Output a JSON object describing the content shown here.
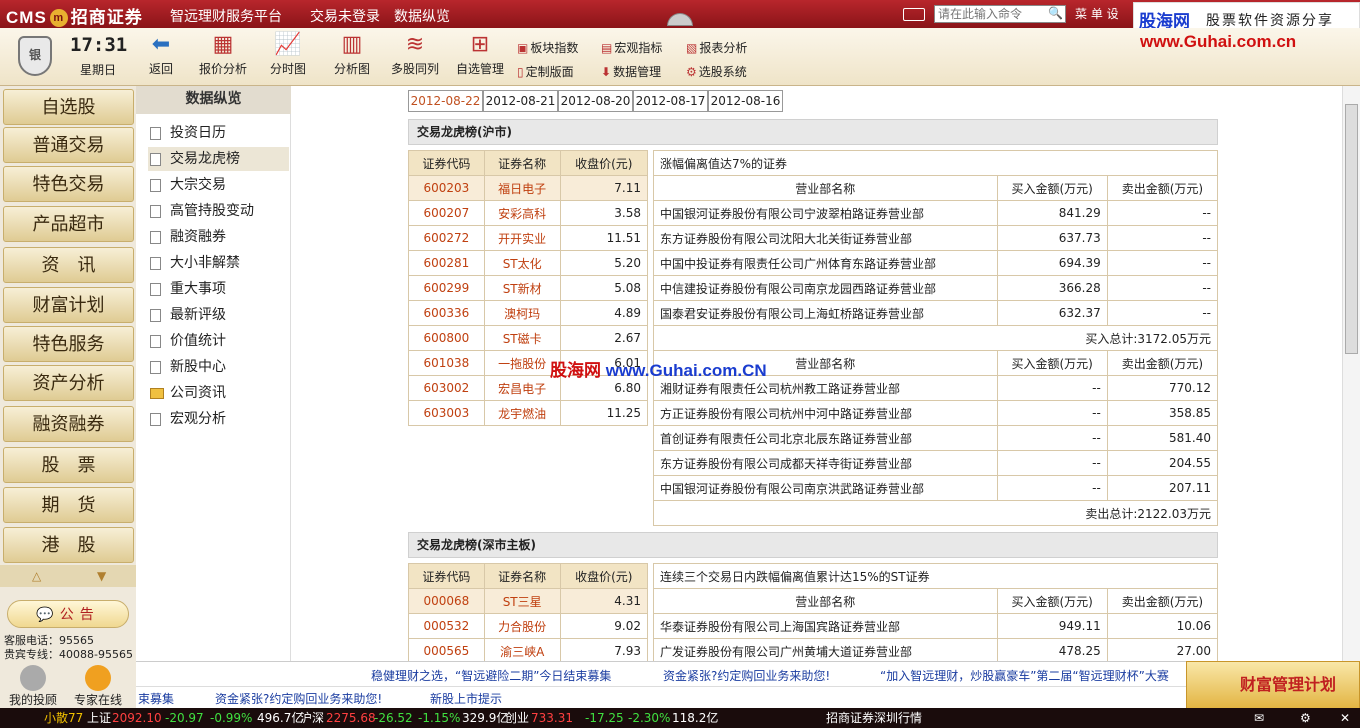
{
  "titlebar": {
    "logo_text": "CMS",
    "logo_badge": "m",
    "brand": "招商证券",
    "menu1": "智远理财服务平台",
    "menu2": "交易未登录",
    "menu3": "数据纵览",
    "cmd_placeholder": "请在此输入命令",
    "menu_btn": "菜 单  设"
  },
  "watermark": {
    "site": "股海网",
    "slogan": "股票软件资源分享",
    "url": "www.Guhai.com.cn",
    "overlay_site": "股海网",
    "overlay_url": "www.Guhai.com.CN"
  },
  "clock": {
    "time": "17:31",
    "weekday": "星期日",
    "shield": "银"
  },
  "toolbar": {
    "back": "返回",
    "quote": "报价分析",
    "minute": "分时图",
    "kline": "分析图",
    "multi": "多股同列",
    "self": "自选管理",
    "sector": "板块指数",
    "macro": "宏观指标",
    "report": "报表分析",
    "custom": "定制版面",
    "datamgr": "数据管理",
    "picker": "选股系统"
  },
  "nav": [
    "自选股",
    "普通交易",
    "特色交易",
    "产品超市",
    "资　讯",
    "财富计划",
    "特色服务",
    "资产分析",
    "融资融券",
    "股　票",
    "期　货",
    "港　股"
  ],
  "left": {
    "notice": "公告",
    "phone1": "客服电话：95565",
    "phone2": "贵宾专线：40088-95565",
    "my": "我的投顾",
    "expert": "专家在线"
  },
  "sub": {
    "title": "数据纵览",
    "items": [
      "投资日历",
      "交易龙虎榜",
      "大宗交易",
      "高管持股变动",
      "融资融券",
      "大小非解禁",
      "重大事项",
      "最新评级",
      "价值统计",
      "新股中心",
      "公司资讯",
      "宏观分析"
    ]
  },
  "dates": [
    "2012-08-22",
    "2012-08-21",
    "2012-08-20",
    "2012-08-17",
    "2012-08-16"
  ],
  "sh": {
    "title": "交易龙虎榜(沪市)",
    "headers": [
      "证券代码",
      "证券名称",
      "收盘价(元)"
    ],
    "stocks": [
      [
        "600203",
        "福日电子",
        "7.11"
      ],
      [
        "600207",
        "安彩高科",
        "3.58"
      ],
      [
        "600272",
        "开开实业",
        "11.51"
      ],
      [
        "600281",
        "ST太化",
        "5.20"
      ],
      [
        "600299",
        "ST新材",
        "5.08"
      ],
      [
        "600336",
        "澳柯玛",
        "4.89"
      ],
      [
        "600800",
        "ST磁卡",
        "2.67"
      ],
      [
        "601038",
        "一拖股份",
        "6.01"
      ],
      [
        "603002",
        "宏昌电子",
        "6.80"
      ],
      [
        "603003",
        "龙宇燃油",
        "11.25"
      ]
    ],
    "caption": "涨幅偏离值达7%的证券",
    "dept_headers": [
      "营业部名称",
      "买入金额(万元)",
      "卖出金额(万元)"
    ],
    "buy": [
      [
        "中国银河证券股份有限公司宁波翠柏路证券营业部",
        "841.29",
        "--"
      ],
      [
        "东方证券股份有限公司沈阳大北关街证券营业部",
        "637.73",
        "--"
      ],
      [
        "中国中投证券有限责任公司广州体育东路证券营业部",
        "694.39",
        "--"
      ],
      [
        "中信建投证券股份有限公司南京龙园西路证券营业部",
        "366.28",
        "--"
      ],
      [
        "国泰君安证券股份有限公司上海虹桥路证券营业部",
        "632.37",
        "--"
      ]
    ],
    "buy_total": "买入总计:3172.05万元",
    "sell": [
      [
        "湘财证券有限责任公司杭州教工路证券营业部",
        "--",
        "770.12"
      ],
      [
        "方正证券股份有限公司杭州中河中路证券营业部",
        "--",
        "358.85"
      ],
      [
        "首创证券有限责任公司北京北辰东路证券营业部",
        "--",
        "581.40"
      ],
      [
        "东方证券股份有限公司成都天祥寺街证券营业部",
        "--",
        "204.55"
      ],
      [
        "中国银河证券股份有限公司南京洪武路证券营业部",
        "--",
        "207.11"
      ]
    ],
    "sell_total": "卖出总计:2122.03万元"
  },
  "sz": {
    "title": "交易龙虎榜(深市主板)",
    "headers": [
      "证券代码",
      "证券名称",
      "收盘价(元)"
    ],
    "stocks": [
      [
        "000068",
        "ST三星",
        "4.31"
      ],
      [
        "000532",
        "力合股份",
        "9.02"
      ],
      [
        "000565",
        "渝三峡A",
        "7.93"
      ]
    ],
    "caption": "连续三个交易日内跌幅偏离值累计达15%的ST证券",
    "dept_headers": [
      "营业部名称",
      "买入金额(万元)",
      "卖出金额(万元)"
    ],
    "rows": [
      [
        "华泰证券股份有限公司上海国宾路证券营业部",
        "949.11",
        "10.06"
      ],
      [
        "广发证券股份有限公司广州黄埔大道证券营业部",
        "478.25",
        "27.00"
      ]
    ]
  },
  "ticker1": [
    "稳健理财之选，“智远避险二期”今日结束募集",
    "资金紧张?约定购回业务来助您!",
    "“加入智远理财，炒股赢豪车”第二届“智远理财杯”大赛"
  ],
  "ticker2": [
    "束募集",
    "资金紧张?约定购回业务来助您!",
    "新股上市提示"
  ],
  "wealth": "财富管理计划",
  "status": {
    "user": "小散77",
    "sh_label": "上证",
    "sh": "2092.10",
    "sh_chg": "-20.97",
    "sh_pct": "-0.99%",
    "sh_amt": "496.7亿",
    "sz_label": "沪深",
    "sz": "2275.68",
    "sz_chg": "-26.52",
    "sz_pct": "-1.15%",
    "sz_amt": "329.9亿",
    "cy_label": "创业",
    "cy": "733.31",
    "cy_chg": "-17.25",
    "cy_pct": "-2.30%",
    "cy_amt": "118.2亿",
    "broker": "招商证券深圳行情"
  }
}
